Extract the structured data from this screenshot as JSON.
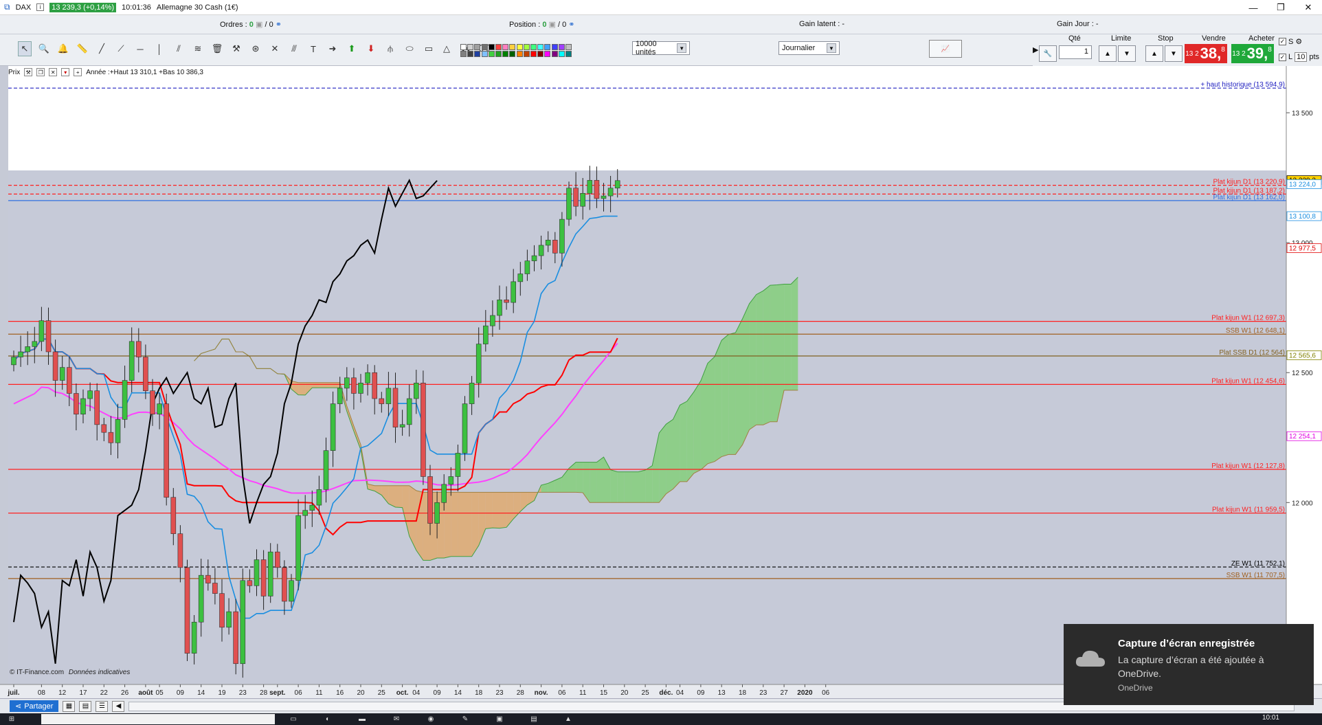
{
  "window": {
    "app_label": "DAX",
    "quote": "13 239,3 (+0,14%)",
    "time": "10:01:36",
    "instrument": "Allemagne 30 Cash (1€)"
  },
  "infobar": {
    "orders_label": "Ordres :",
    "orders_value": "0",
    "orders_sep": "/ 0",
    "position_label": "Position :",
    "position_value": "0",
    "position_sep": "/ 0",
    "latent_label": "Gain latent : -",
    "day_label": "Gain Jour : -"
  },
  "toolbar": {
    "units_select": "10000 unités",
    "period_select": "Journalier",
    "swatches": [
      "#ffffff",
      "#d0d0d0",
      "#a0a0a0",
      "#707070",
      "#000000",
      "#ff4040",
      "#ff80c0",
      "#ffd040",
      "#ffff40",
      "#a0ff40",
      "#40ff80",
      "#40ffff",
      "#40a0ff",
      "#4040ff",
      "#a040ff",
      "#c0c0c0",
      "#808080",
      "#404040",
      "#2040a0",
      "#80c0ff",
      "#40d040",
      "#20a020",
      "#008000",
      "#006000",
      "#ff8000",
      "#c04000",
      "#ff0000",
      "#800000",
      "#ff00ff",
      "#800080",
      "#00ffff",
      "#008080"
    ]
  },
  "orderpanel": {
    "qty_label": "Qté",
    "qty_value": "1",
    "limit_label": "Limite",
    "stop_label": "Stop",
    "sell_label": "Vendre",
    "buy_label": "Acheter",
    "sell_small": "13 2",
    "sell_big": "38,",
    "sell_sup": "8",
    "buy_small": "13 2",
    "buy_big": "39,",
    "buy_sup": "8",
    "s_label": "S",
    "l_label": "L",
    "pts_value": "10",
    "pts_label": "pts"
  },
  "chart_header": {
    "label": "Prix",
    "annotation": "Année :+Haut 13 310,1 +Bas 10 386,3"
  },
  "chart_data": {
    "type": "candlestick",
    "ylim": [
      11300,
      13680
    ],
    "y_ticks": [
      {
        "value": 13500,
        "label": "13 500"
      },
      {
        "value": 13000,
        "label": "13 000"
      },
      {
        "value": 12500,
        "label": "12 500"
      },
      {
        "value": 12000,
        "label": "12 000"
      }
    ],
    "x_labels": [
      {
        "i": 0,
        "label": "juil.",
        "bold": true
      },
      {
        "i": 4,
        "label": "08"
      },
      {
        "i": 7,
        "label": "12"
      },
      {
        "i": 10,
        "label": "17"
      },
      {
        "i": 13,
        "label": "22"
      },
      {
        "i": 16,
        "label": "26"
      },
      {
        "i": 19,
        "label": "août",
        "bold": true
      },
      {
        "i": 21,
        "label": "05"
      },
      {
        "i": 24,
        "label": "09"
      },
      {
        "i": 27,
        "label": "14"
      },
      {
        "i": 30,
        "label": "19"
      },
      {
        "i": 33,
        "label": "23"
      },
      {
        "i": 36,
        "label": "28"
      },
      {
        "i": 38,
        "label": "sept.",
        "bold": true
      },
      {
        "i": 41,
        "label": "06"
      },
      {
        "i": 44,
        "label": "11"
      },
      {
        "i": 47,
        "label": "16"
      },
      {
        "i": 50,
        "label": "20"
      },
      {
        "i": 53,
        "label": "25"
      },
      {
        "i": 56,
        "label": "oct.",
        "bold": true
      },
      {
        "i": 58,
        "label": "04"
      },
      {
        "i": 61,
        "label": "09"
      },
      {
        "i": 64,
        "label": "14"
      },
      {
        "i": 67,
        "label": "18"
      },
      {
        "i": 70,
        "label": "23"
      },
      {
        "i": 73,
        "label": "28"
      },
      {
        "i": 76,
        "label": "nov.",
        "bold": true
      },
      {
        "i": 79,
        "label": "06"
      },
      {
        "i": 82,
        "label": "11"
      },
      {
        "i": 85,
        "label": "15"
      },
      {
        "i": 88,
        "label": "20"
      },
      {
        "i": 91,
        "label": "25"
      },
      {
        "i": 94,
        "label": "déc.",
        "bold": true
      },
      {
        "i": 96,
        "label": "04"
      },
      {
        "i": 99,
        "label": "09"
      },
      {
        "i": 102,
        "label": "13"
      },
      {
        "i": 105,
        "label": "18"
      },
      {
        "i": 108,
        "label": "23"
      },
      {
        "i": 111,
        "label": "27"
      },
      {
        "i": 114,
        "label": "2020",
        "bold": true
      },
      {
        "i": 117,
        "label": "06"
      }
    ],
    "closes": [
      12560,
      12580,
      12600,
      12620,
      12700,
      12580,
      12470,
      12520,
      12420,
      12340,
      12400,
      12430,
      12300,
      12270,
      12230,
      12320,
      12470,
      12620,
      12560,
      12430,
      12340,
      12380,
      12020,
      11880,
      11750,
      11420,
      11540,
      11720,
      11690,
      11650,
      11520,
      11580,
      11380,
      11700,
      11680,
      11780,
      11640,
      11810,
      11750,
      11620,
      11700,
      11950,
      11970,
      11990,
      12050,
      12200,
      12380,
      12440,
      12480,
      12420,
      12460,
      12500,
      12400,
      12380,
      12440,
      12290,
      12300,
      12400,
      12460,
      12100,
      11920,
      12000,
      12070,
      12100,
      12190,
      12380,
      12460,
      12610,
      12680,
      12720,
      12780,
      12770,
      12850,
      12880,
      12930,
      12950,
      12990,
      13010,
      12960,
      13090,
      13210,
      13140,
      13190,
      13240,
      13170,
      13180,
      13210,
      13239
    ],
    "plat_kijun_d1": {
      "value": 13220.9,
      "label": "Plat kijun D1 (13 220,9)"
    },
    "plat_kijun_d1_2": {
      "value": 13187.2,
      "label": "Plat kijun D1 (13 187,2)"
    },
    "plat_kijun_d1_3": {
      "value": 13162,
      "label": "Plat kijun D1 (13 162,0)"
    },
    "haut_historique": {
      "value": 13594.9,
      "label": "+ haut historique (13 594,9)"
    },
    "horizontal_lines": [
      {
        "value": 12697.3,
        "label": "Plat kijun W1 (12 697,3)",
        "color": "#ff2020",
        "style": "solid"
      },
      {
        "value": 12648.1,
        "label": "SSB W1 (12 648,1)",
        "color": "#a06020",
        "style": "solid"
      },
      {
        "value": 12564,
        "label": "Plat SSB D1 (12 564)",
        "color": "#806020",
        "style": "solid"
      },
      {
        "value": 12454.6,
        "label": "Plat kijun W1 (12 454,6)",
        "color": "#ff2020",
        "style": "solid"
      },
      {
        "value": 12127.8,
        "label": "Plat kijun W1 (12 127,8)",
        "color": "#ff2020",
        "style": "solid"
      },
      {
        "value": 11959.5,
        "label": "Plat kijun W1 (11 959,5)",
        "color": "#ff2020",
        "style": "solid"
      },
      {
        "value": 11752.1,
        "label": "ZE W1 (11 752,1)",
        "color": "#000000",
        "style": "dashed"
      },
      {
        "value": 11707.5,
        "label": "SSB W1 (11 707,5)",
        "color": "#a06020",
        "style": "solid"
      }
    ],
    "price_tags": [
      {
        "value": 13239.3,
        "label": "13 239,3",
        "bg": "#ffd200",
        "fg": "#000000"
      },
      {
        "value": 13224,
        "label": "13 224,0",
        "bg": "#ffffff",
        "fg": "#1a8ee0"
      },
      {
        "value": 13100.8,
        "label": "13 100,8",
        "bg": "#ffffff",
        "fg": "#1a8ee0"
      },
      {
        "value": 12977.5,
        "label": "12 977,5",
        "bg": "#ffffff",
        "fg": "#e00000"
      },
      {
        "value": 12565.6,
        "label": "12 565,6",
        "bg": "#ffffff",
        "fg": "#808000"
      },
      {
        "value": 12254.1,
        "label": "12 254,1",
        "bg": "#ffffff",
        "fg": "#e000e0"
      }
    ],
    "source_label": "© IT-Finance.com",
    "source_note": "Données indicatives",
    "colors": {
      "up": "#3cc040",
      "down": "#e05050",
      "kijun": "#ff0000",
      "tenkan": "#1a8ee0",
      "chikou": "#000000",
      "ma": "#ff40ff",
      "cloud_up": "#e8a050",
      "cloud_down": "#70d060"
    }
  },
  "footer": {
    "share_label": "Partager"
  },
  "taskbar": {
    "time": "10:01"
  },
  "toast": {
    "title": "Capture d’écran enregistrée",
    "body": "La capture d’écran a été ajoutée à OneDrive.",
    "source": "OneDrive"
  }
}
